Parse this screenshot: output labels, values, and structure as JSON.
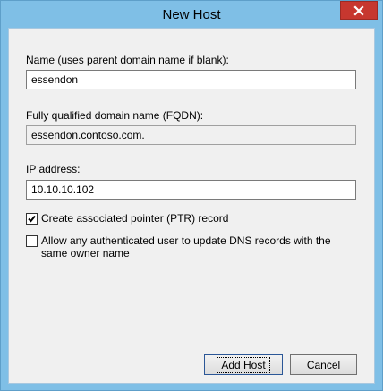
{
  "window": {
    "title": "New Host"
  },
  "form": {
    "name_label": "Name (uses parent domain name if blank):",
    "name_value": "essendon",
    "fqdn_label": "Fully qualified domain name (FQDN):",
    "fqdn_value": "essendon.contoso.com.",
    "ip_label": "IP address:",
    "ip_value": "10.10.10.102",
    "ptr_label": "Create associated pointer (PTR) record",
    "ptr_checked": true,
    "allow_label": "Allow any authenticated user to update DNS records with the same owner name",
    "allow_checked": false
  },
  "buttons": {
    "add_host": "Add Host",
    "cancel": "Cancel"
  },
  "icons": {
    "close": "close-icon",
    "check": "checkmark-icon"
  },
  "colors": {
    "titlebar": "#7fbfe6",
    "close": "#c7372f",
    "client": "#f0f0f0"
  }
}
